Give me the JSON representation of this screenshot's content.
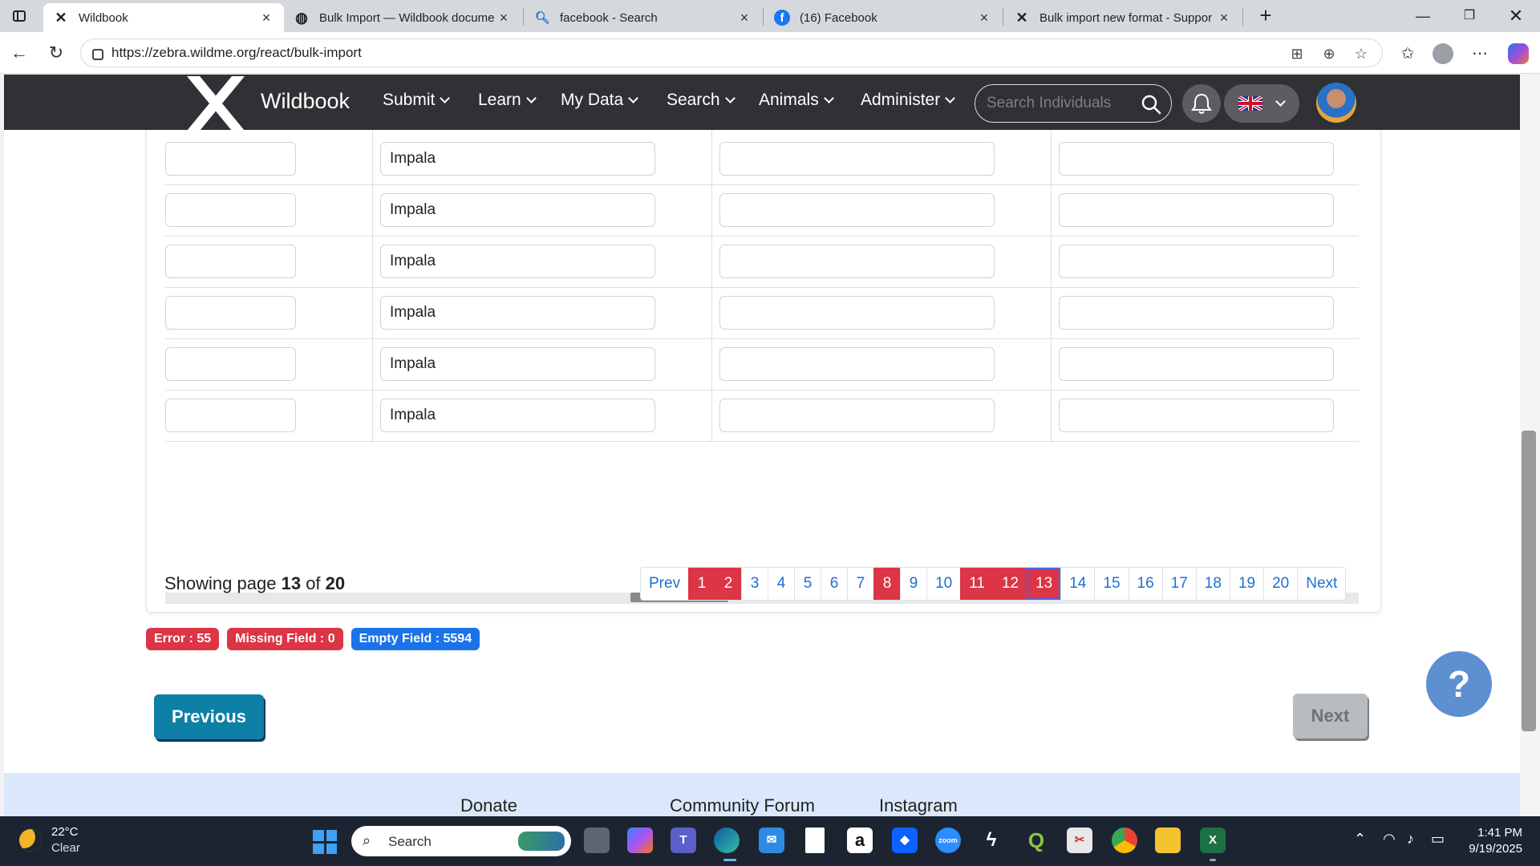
{
  "browser": {
    "tabs": [
      {
        "title": "Wildbook",
        "favicon": "x-logo-icon"
      },
      {
        "title": "Bulk Import — Wildbook docume",
        "favicon": "globe-icon"
      },
      {
        "title": "facebook - Search",
        "favicon": "search-icon"
      },
      {
        "title": "(16) Facebook",
        "favicon": "facebook-icon"
      },
      {
        "title": "Bulk import new format - Suppor",
        "favicon": "x-logo-icon"
      }
    ],
    "url": "https://zebra.wildme.org/react/bulk-import"
  },
  "nav": {
    "brand": "Wildbook",
    "menus": [
      "Submit",
      "Learn",
      "My Data",
      "Search",
      "Animals",
      "Administer"
    ],
    "search_placeholder": "Search Individuals"
  },
  "table": {
    "rows": [
      {
        "species": "Impala"
      },
      {
        "species": "Impala"
      },
      {
        "species": "Impala"
      },
      {
        "species": "Impala"
      },
      {
        "species": "Impala"
      },
      {
        "species": "Impala"
      }
    ]
  },
  "pagination": {
    "showing_prefix": "Showing page",
    "current": "13",
    "of_label": "of",
    "total": "20",
    "prev_label": "Prev",
    "next_label": "Next",
    "pages": [
      "1",
      "2",
      "3",
      "4",
      "5",
      "6",
      "7",
      "8",
      "9",
      "10",
      "11",
      "12",
      "13",
      "14",
      "15",
      "16",
      "17",
      "18",
      "19",
      "20"
    ],
    "error_pages": [
      "1",
      "2",
      "8",
      "11",
      "12",
      "13"
    ]
  },
  "badges": {
    "error": "Error : 55",
    "missing": "Missing Field : 0",
    "empty": "Empty Field : 5594"
  },
  "actions": {
    "previous": "Previous",
    "next": "Next",
    "help": "?"
  },
  "footer": {
    "links": [
      "Donate",
      "Community Forum",
      "Instagram"
    ]
  },
  "taskbar": {
    "temp": "22°C",
    "condition": "Clear",
    "search_label": "Search",
    "time": "1:41 PM",
    "date": "9/19/2025"
  },
  "colors": {
    "nav_bg": "#2f3134",
    "error_red": "#dc3545",
    "link_blue": "#1f6fd1",
    "primary_teal": "#0e7fa6"
  }
}
